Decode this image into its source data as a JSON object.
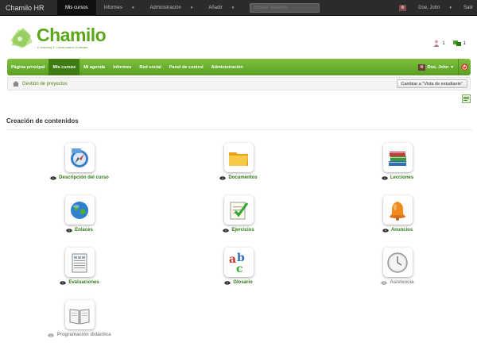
{
  "topbar": {
    "brand": "Chamilo HR",
    "nav": [
      {
        "label": "Mis cursos",
        "caret": ""
      },
      {
        "label": "Informes",
        "caret": "▾"
      },
      {
        "label": "Administración",
        "caret": "▾"
      },
      {
        "label": "Añadir",
        "caret": "▾"
      }
    ],
    "search_placeholder": "Buscar usuarios",
    "user": "Doe, John",
    "logout": "Salir"
  },
  "logo": {
    "name": "Chamilo",
    "tagline": "E-learning & Collaboration Software"
  },
  "header_counts": {
    "users": "1",
    "groups": "1"
  },
  "green_nav": {
    "items": [
      "Página principal",
      "Mis cursos",
      "Mi agenda",
      "Informes",
      "Red social",
      "Panel de control",
      "Administración"
    ],
    "user": "Doe, John"
  },
  "breadcrumb": {
    "label": "Gestión de proyectos",
    "switch_button": "Cambiar a \"Vista de estudiante\""
  },
  "section": {
    "title": "Creación de contenidos"
  },
  "tools": [
    {
      "label": "Descripción del curso",
      "icon": "course-description-icon",
      "visible": true
    },
    {
      "label": "Documentos",
      "icon": "documents-icon",
      "visible": true
    },
    {
      "label": "Lecciones",
      "icon": "lessons-icon",
      "visible": true
    },
    {
      "label": "Enlaces",
      "icon": "links-icon",
      "visible": true
    },
    {
      "label": "Ejercicios",
      "icon": "exercises-icon",
      "visible": true
    },
    {
      "label": "Anuncios",
      "icon": "announcements-icon",
      "visible": true
    },
    {
      "label": "Evaluaciones",
      "icon": "assessments-icon",
      "visible": true
    },
    {
      "label": "Glosario",
      "icon": "glossary-icon",
      "visible": true
    },
    {
      "label": "Asistencia",
      "icon": "attendance-icon",
      "visible": false
    },
    {
      "label": "Programación didáctica",
      "icon": "course-progress-icon",
      "visible": false
    }
  ],
  "colors": {
    "accent_green": "#5a9f22",
    "link_green": "#2c7a12",
    "topbar": "#2b2b2b",
    "muted": "#8c8c8c"
  }
}
